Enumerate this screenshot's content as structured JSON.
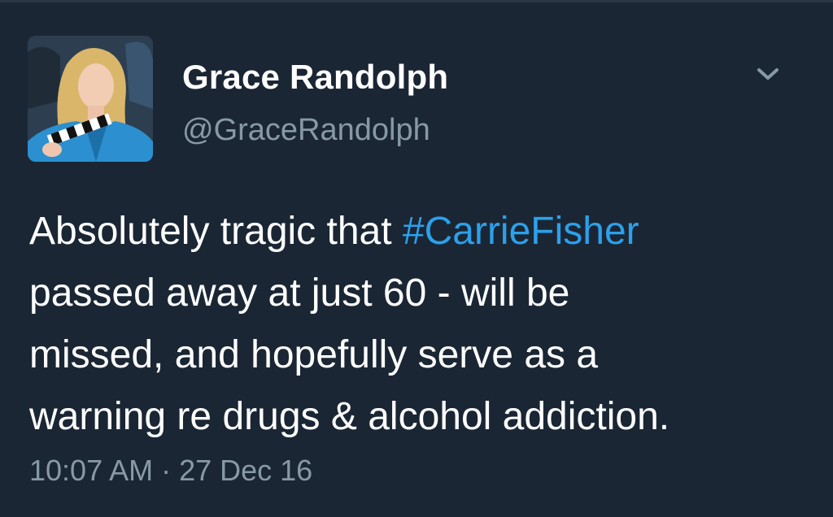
{
  "author": {
    "display_name": "Grace Randolph",
    "handle": "@GraceRandolph"
  },
  "tweet": {
    "line1_prefix": "Absolutely tragic that ",
    "hashtag": "#CarrieFisher",
    "line2": "passed away at just 60 - will be",
    "line3": "missed, and hopefully serve as a",
    "line4": "warning re drugs & alcohol addiction."
  },
  "meta": {
    "timestamp": "10:07 AM · 27 Dec 16"
  },
  "icons": {
    "menu": "chevron-down-icon"
  },
  "colors": {
    "background": "#1b2634",
    "text": "#ffffff",
    "secondary": "#8899a6",
    "link": "#2ba1eb"
  }
}
